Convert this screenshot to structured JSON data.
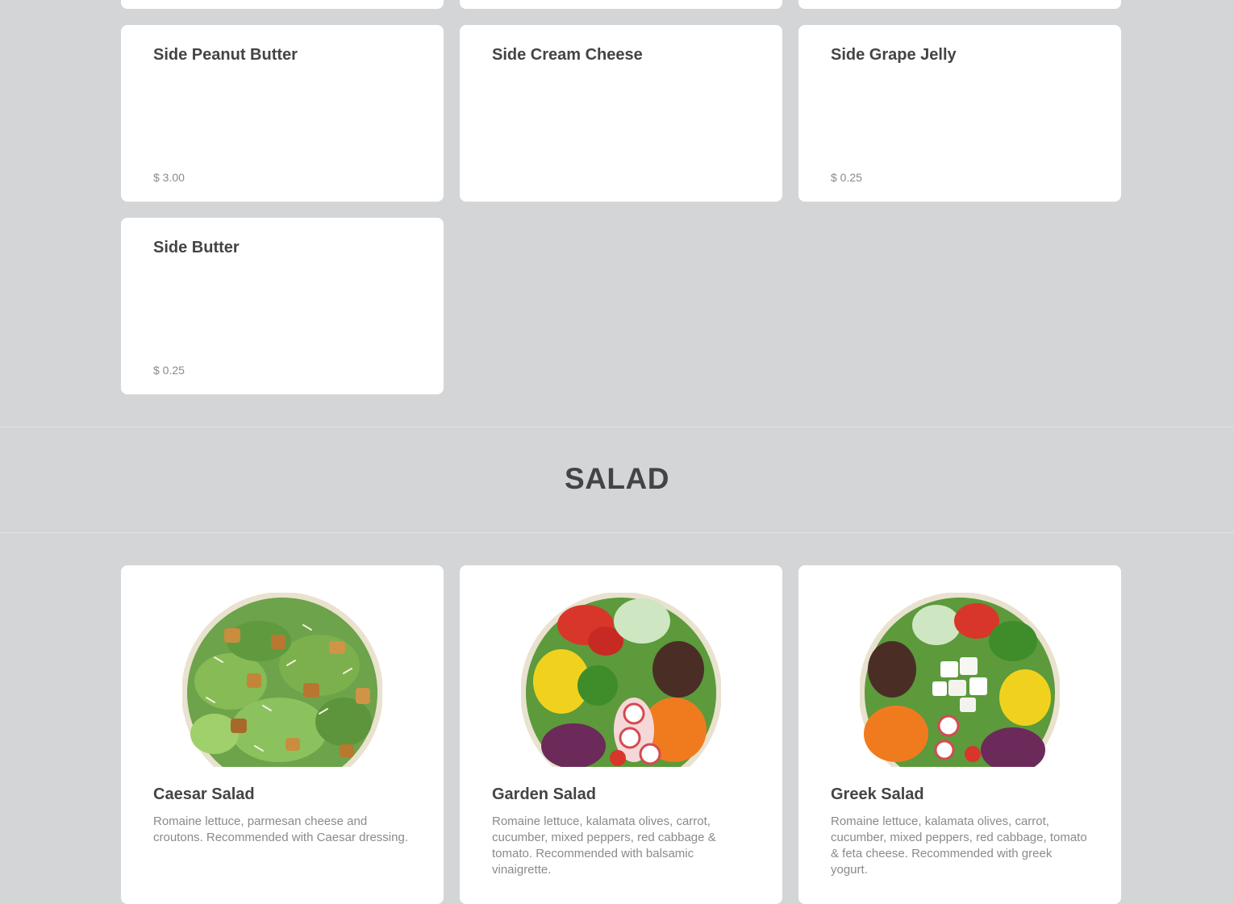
{
  "sides": {
    "items": [
      {
        "name": "Side Peanut Butter",
        "price": "$ 3.00"
      },
      {
        "name": "Side Cream Cheese",
        "price": ""
      },
      {
        "name": "Side Grape Jelly",
        "price": "$ 0.25"
      },
      {
        "name": "Side Butter",
        "price": "$ 0.25"
      }
    ]
  },
  "salad_section": {
    "title": "SALAD",
    "items": [
      {
        "name": "Caesar Salad",
        "description": "Romaine lettuce, parmesan cheese and croutons. Recommended with Caesar dressing.",
        "image_icon": "caesar-salad-image"
      },
      {
        "name": "Garden Salad",
        "description": "Romaine lettuce, kalamata olives, carrot, cucumber, mixed peppers, red cabbage & tomato. Recommended with balsamic vinaigrette.",
        "image_icon": "garden-salad-image"
      },
      {
        "name": "Greek Salad",
        "description": "Romaine lettuce, kalamata olives, carrot, cucumber, mixed peppers, red cabbage, tomato & feta cheese. Recommended with greek yogurt.",
        "image_icon": "greek-salad-image"
      }
    ]
  },
  "colors": {
    "page_background": "#d4d5d7",
    "card_background": "#ffffff",
    "title_text": "#444444",
    "muted_text": "#8a8a8a"
  }
}
